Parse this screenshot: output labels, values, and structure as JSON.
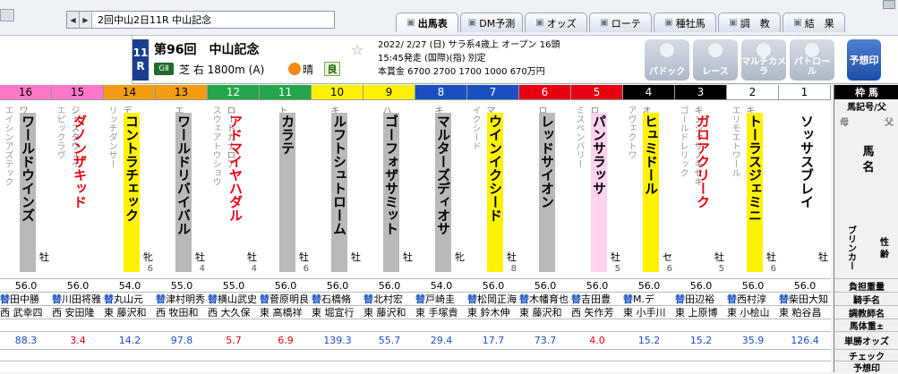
{
  "race_select": {
    "value": "2回中山2日11R 中山記念"
  },
  "tabs": [
    {
      "label": "出馬表",
      "active": true
    },
    {
      "label": "DM予測"
    },
    {
      "label": "オッズ"
    },
    {
      "label": "ローテ"
    },
    {
      "label": "種牡馬"
    },
    {
      "label": "調　教"
    },
    {
      "label": "結　果"
    }
  ],
  "race": {
    "num_top": "11",
    "num_bottom": "R",
    "title": "第96回　中山記念",
    "grade": "GⅡ",
    "course": "芝 右 1800m (A)",
    "weather": "晴",
    "baba": "良",
    "info1": "2022/ 2/27 (日)  サラ系4歳上 オープン 16頭",
    "info2": "15:45発走 (国際)(指) 別定",
    "info3": "本賞金 6700 2700 1700 1000 670万円"
  },
  "buttons": [
    "パドック",
    "レース",
    "マルチカメラ",
    "パトロール"
  ],
  "yoso_button": "予想印",
  "colors": {
    "frame1": "#ffffff",
    "frame2": "#000000",
    "frame3": "#e60012",
    "frame4": "#1b4fbf",
    "frame5": "#fff200",
    "frame6": "#22a54b",
    "frame7": "#f39c12",
    "frame8": "#ff77c8"
  },
  "labels": {
    "cap": "枠 馬",
    "pedigree_head": "馬記号/父",
    "haha": "母",
    "umamei": "馬 名",
    "chichi": "父",
    "blinker": "ブリンカー",
    "sex": "性 齢",
    "weight": "負担重量",
    "rider": "騎手名",
    "trainer": "調教師名",
    "body": "馬体重±",
    "odds": "単勝オッズ",
    "check": "チェック",
    "mark": "予想印"
  },
  "horses": [
    {
      "waku": "8",
      "uma": "16",
      "name": "ワールドウインズ",
      "sire": "ワークフォース",
      "dam": "エイシンアズテック",
      "cls": "g",
      "sex": "牡",
      "age": "",
      "wt": "56.0",
      "rider": "田中勝",
      "trainer": "西 武幸四",
      "odds": "88.3"
    },
    {
      "waku": "8",
      "uma": "15",
      "name": "ダノンザキッド",
      "sire": "ジャスタウェイ",
      "dam": "エピックラヴ",
      "cls": "r",
      "sex": "",
      "age": "",
      "wt": "56.0",
      "rider": "川田将雅",
      "trainer": "西 安田隆",
      "odds": "3.4"
    },
    {
      "waku": "7",
      "uma": "14",
      "name": "コントラチェック",
      "sire": "ディープインパクト",
      "dam": "リッチダンサー",
      "cls": "y",
      "sex": "牝",
      "age": "6",
      "wt": "54.0",
      "rider": "丸山元",
      "trainer": "東 藤沢和",
      "odds": "14.2"
    },
    {
      "waku": "7",
      "uma": "13",
      "name": "ワールドリバイバル",
      "sire": "エピファネイア",
      "dam": "",
      "cls": "g",
      "sex": "牡",
      "age": "4",
      "wt": "55.0",
      "rider": "津村明秀",
      "trainer": "西 牧田和",
      "odds": "97.8"
    },
    {
      "waku": "6",
      "uma": "12",
      "name": "アドマイヤハダル",
      "sire": "ロードカナロア",
      "dam": "スウェアトウショウ",
      "cls": "r",
      "sex": "牡",
      "age": "4",
      "wt": "55.0",
      "rider": "横山武史",
      "trainer": "西 大久保",
      "odds": "5.7"
    },
    {
      "waku": "6",
      "uma": "11",
      "name": "カラテ",
      "sire": "トゥザグローリー",
      "dam": "",
      "cls": "g",
      "sex": "牡",
      "age": "6",
      "wt": "56.0",
      "rider": "菅原明良",
      "trainer": "東 高橋祥",
      "odds": "6.9"
    },
    {
      "waku": "5",
      "uma": "10",
      "name": "ルフトシュトローム",
      "sire": "キンシャサノキセキ",
      "dam": "",
      "cls": "g",
      "sex": "牡",
      "age": "",
      "wt": "56.0",
      "rider": "石橋脩",
      "trainer": "東 堀宣行",
      "odds": "139.3"
    },
    {
      "waku": "5",
      "uma": "9",
      "name": "ゴーフォザサミット",
      "sire": "ハーツクライ",
      "dam": "",
      "cls": "g",
      "sex": "牡",
      "age": "",
      "wt": "56.0",
      "rider": "北村宏",
      "trainer": "東 藤沢和",
      "odds": "55.7"
    },
    {
      "waku": "4",
      "uma": "8",
      "name": "マルターズディオサ",
      "sire": "キズナ",
      "dam": "",
      "cls": "g",
      "sex": "牝",
      "age": "",
      "wt": "54.0",
      "rider": "戸崎圭",
      "trainer": "東 手塚貴",
      "odds": "29.4"
    },
    {
      "waku": "4",
      "uma": "7",
      "name": "ウインイクシード",
      "sire": "マンハッタンカフェ",
      "dam": "イクシード",
      "cls": "y",
      "sex": "牡",
      "age": "8",
      "wt": "56.0",
      "rider": "松岡正海",
      "trainer": "東 鈴木伸",
      "odds": "17.7"
    },
    {
      "waku": "3",
      "uma": "6",
      "name": "レッドサイオン",
      "sire": "ロードカナロア",
      "dam": "",
      "cls": "g",
      "sex": "",
      "age": "",
      "wt": "56.0",
      "rider": "木幡育也",
      "trainer": "東 藤沢和",
      "odds": "73.7"
    },
    {
      "waku": "3",
      "uma": "5",
      "name": "パンサラッサ",
      "sire": "ロードカナロア",
      "dam": "ミスペンバリー",
      "cls": "p",
      "sex": "牡",
      "age": "5",
      "wt": "56.0",
      "rider": "吉田豊",
      "trainer": "西 矢作芳",
      "odds": "4.0"
    },
    {
      "waku": "2",
      "uma": "4",
      "name": "ヒュミドール",
      "sire": "オルフェーヴル",
      "dam": "アヴェクトワ",
      "cls": "y",
      "sex": "セ",
      "age": "6",
      "wt": "56.0",
      "rider": "M.デ",
      "trainer": "東 小手川",
      "odds": "15.2"
    },
    {
      "waku": "2",
      "uma": "3",
      "name": "ガロアクリーク",
      "sire": "キンシャサノキセキ",
      "dam": "ゴールドレリック",
      "cls": "r",
      "sex": "牡",
      "age": "5",
      "wt": "56.0",
      "rider": "田辺裕",
      "trainer": "東 上原博",
      "odds": "15.2"
    },
    {
      "waku": "1",
      "uma": "2",
      "name": "トーラスジェミニ",
      "sire": "キングズベスト",
      "dam": "エリモエトワール",
      "cls": "y",
      "sex": "牡",
      "age": "6",
      "wt": "56.0",
      "rider": "西村淳",
      "trainer": "東 小桧山",
      "odds": "35.9"
    },
    {
      "waku": "1",
      "uma": "1",
      "name": "ソッサスブレイ",
      "sire": "",
      "dam": "",
      "cls": "w",
      "sex": "牡",
      "age": "",
      "wt": "56.0",
      "rider": "柴田大知",
      "trainer": "東 粕谷昌",
      "odds": "126.4"
    }
  ]
}
